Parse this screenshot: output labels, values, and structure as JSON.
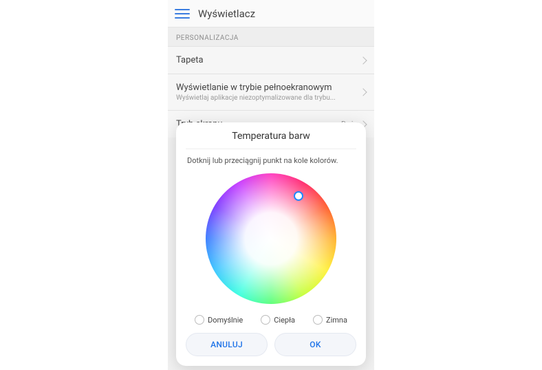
{
  "header": {
    "title": "Wyświetlacz"
  },
  "section": {
    "header": "PERSONALIZACJA",
    "items": [
      {
        "title": "Tapeta",
        "subtitle": "",
        "value": ""
      },
      {
        "title": "Wyświetlanie w trybie pełnoekranowym",
        "subtitle": "Wyświetlaj aplikacje niezoptymalizowane dla trybu...",
        "value": ""
      },
      {
        "title": "Tryb ekranu",
        "subtitle": "",
        "value": "Duży"
      }
    ]
  },
  "dialog": {
    "title": "Temperatura barw",
    "instruction": "Dotknij lub przeciągnij punkt na kole kolorów.",
    "radios": [
      {
        "label": "Domyślnie"
      },
      {
        "label": "Ciepła"
      },
      {
        "label": "Zimna"
      }
    ],
    "cancel_label": "ANULUJ",
    "ok_label": "OK"
  }
}
